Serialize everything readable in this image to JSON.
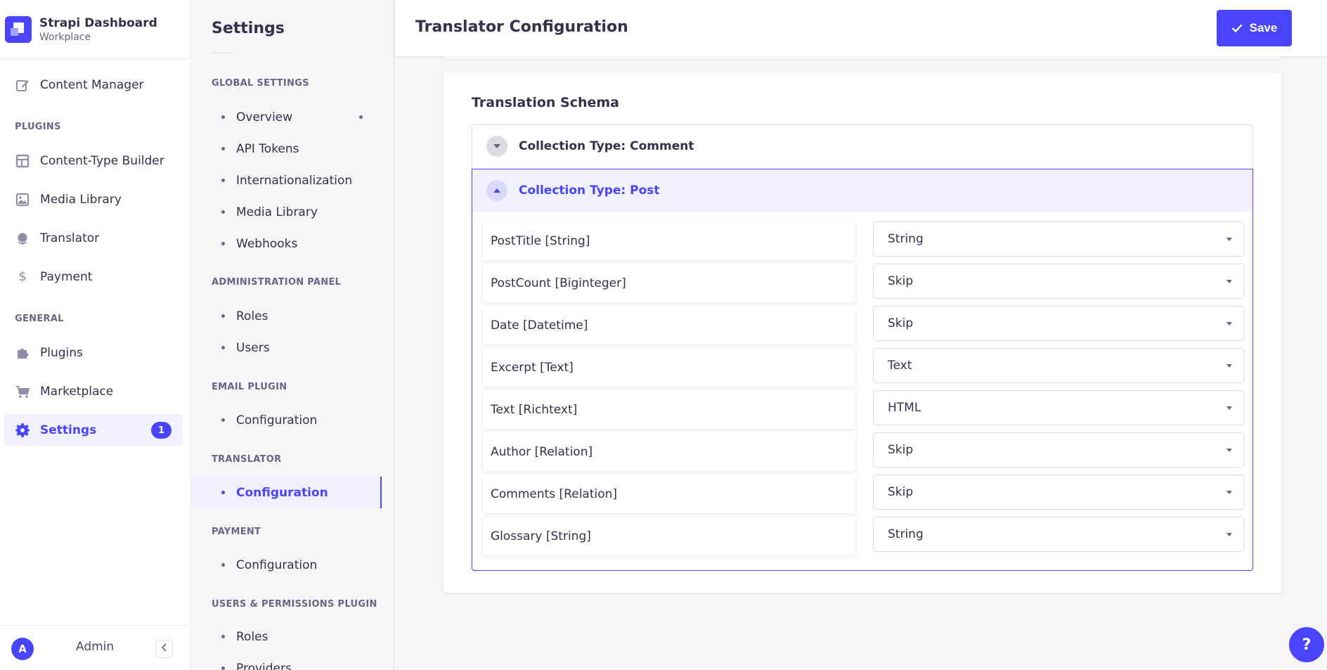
{
  "brand": {
    "title": "Strapi Dashboard",
    "subtitle": "Workplace"
  },
  "main_nav": {
    "content_manager": "Content Manager",
    "plugins_section": "PLUGINS",
    "content_type_builder": "Content-Type Builder",
    "media_library": "Media Library",
    "translator": "Translator",
    "payment": "Payment",
    "general_section": "GENERAL",
    "plugins": "Plugins",
    "marketplace": "Marketplace",
    "settings": "Settings",
    "settings_badge": "1",
    "admin_initial": "A",
    "admin_name": "Admin"
  },
  "sub_nav": {
    "title": "Settings",
    "sections": [
      {
        "label": "GLOBAL SETTINGS",
        "links": [
          "Overview",
          "API Tokens",
          "Internationalization",
          "Media Library",
          "Webhooks"
        ]
      },
      {
        "label": "ADMINISTRATION PANEL",
        "links": [
          "Roles",
          "Users"
        ]
      },
      {
        "label": "EMAIL PLUGIN",
        "links": [
          "Configuration"
        ]
      },
      {
        "label": "TRANSLATOR",
        "links": [
          "Configuration"
        ]
      },
      {
        "label": "PAYMENT",
        "links": [
          "Configuration"
        ]
      },
      {
        "label": "USERS & PERMISSIONS PLUGIN",
        "links": [
          "Roles",
          "Providers"
        ]
      }
    ]
  },
  "header": {
    "title": "Translator Configuration",
    "save_label": "Save"
  },
  "schema": {
    "title": "Translation Schema",
    "collections": [
      {
        "label": "Collection Type: Comment",
        "expanded": false
      },
      {
        "label": "Collection Type: Post",
        "expanded": true
      }
    ],
    "fields": [
      {
        "label": "PostTitle [String]",
        "value": "String"
      },
      {
        "label": "PostCount [Biginteger]",
        "value": "Skip"
      },
      {
        "label": "Date [Datetime]",
        "value": "Skip"
      },
      {
        "label": "Excerpt [Text]",
        "value": "Text"
      },
      {
        "label": "Text [Richtext]",
        "value": "HTML"
      },
      {
        "label": "Author [Relation]",
        "value": "Skip"
      },
      {
        "label": "Comments [Relation]",
        "value": "Skip"
      },
      {
        "label": "Glossary [String]",
        "value": "String"
      }
    ]
  },
  "help_label": "?",
  "colors": {
    "primary": "#4945ff",
    "primary_light": "#f0f0ff",
    "text": "#32324d",
    "muted": "#666687"
  }
}
